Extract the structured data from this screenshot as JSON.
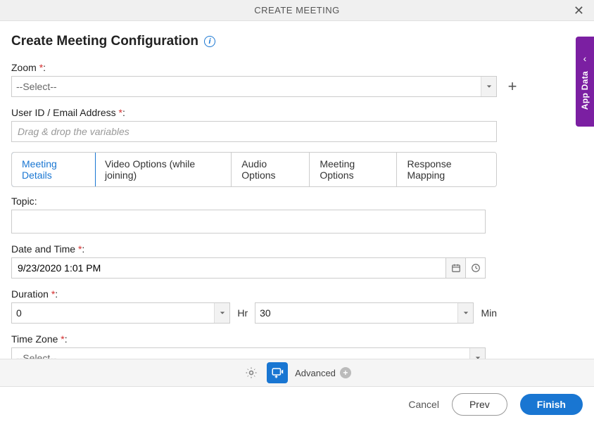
{
  "header": {
    "title": "CREATE MEETING"
  },
  "page_title": "Create Meeting Configuration",
  "sidebar_tab": {
    "label": "App Data"
  },
  "fields": {
    "zoom": {
      "label": "Zoom",
      "required_mark": "*",
      "colon": ":",
      "value": "--Select--"
    },
    "user_id": {
      "label": "User ID / Email Address",
      "required_mark": "*",
      "colon": ":",
      "placeholder": "Drag & drop the variables"
    },
    "topic": {
      "label": "Topic",
      "colon": ":"
    },
    "date_time": {
      "label": "Date and Time",
      "required_mark": "*",
      "colon": ":",
      "value": "9/23/2020 1:01 PM"
    },
    "duration": {
      "label": "Duration",
      "required_mark": "*",
      "colon": ":",
      "hours_value": "0",
      "hours_unit": "Hr",
      "minutes_value": "30",
      "minutes_unit": "Min"
    },
    "timezone": {
      "label": "Time Zone",
      "required_mark": "*",
      "colon": ":",
      "value": "--Select--"
    }
  },
  "tabs": [
    {
      "label": "Meeting Details",
      "active": true
    },
    {
      "label": "Video Options (while joining)",
      "active": false
    },
    {
      "label": "Audio Options",
      "active": false
    },
    {
      "label": "Meeting Options",
      "active": false
    },
    {
      "label": "Response Mapping",
      "active": false
    }
  ],
  "toolbar": {
    "advanced_label": "Advanced"
  },
  "footer": {
    "cancel": "Cancel",
    "prev": "Prev",
    "finish": "Finish"
  }
}
